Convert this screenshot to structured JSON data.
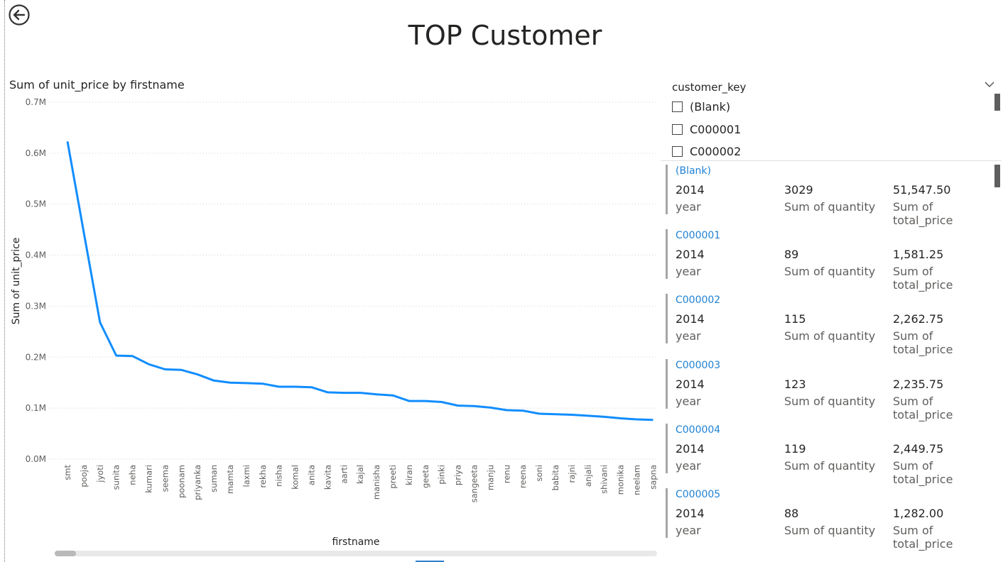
{
  "page": {
    "title": "TOP Customer"
  },
  "chart_data": {
    "type": "line",
    "title": "Sum of unit_price by firstname",
    "xlabel": "firstname",
    "ylabel": "Sum of unit_price",
    "ylim": [
      0,
      700000
    ],
    "yticks": [
      "0.0M",
      "0.1M",
      "0.2M",
      "0.3M",
      "0.4M",
      "0.5M",
      "0.6M",
      "0.7M"
    ],
    "grid": true,
    "color": "#118DFF",
    "categories": [
      "smt",
      "pooja",
      "jyoti",
      "sunita",
      "neha",
      "kumari",
      "seema",
      "poonam",
      "priyanka",
      "suman",
      "mamta",
      "laxmi",
      "rekha",
      "nisha",
      "komal",
      "anita",
      "kavita",
      "aarti",
      "kajal",
      "manisha",
      "preeti",
      "kiran",
      "geeta",
      "pinki",
      "priya",
      "sangeeta",
      "manju",
      "renu",
      "reena",
      "soni",
      "babita",
      "rajni",
      "anjali",
      "shivani",
      "monika",
      "neelam",
      "sapna"
    ],
    "values": [
      623000,
      445000,
      268000,
      203000,
      202000,
      186000,
      176000,
      175000,
      166000,
      154000,
      150000,
      149000,
      148000,
      142000,
      142000,
      141000,
      131000,
      130000,
      130000,
      127000,
      125000,
      114000,
      114000,
      112000,
      105000,
      104000,
      101000,
      96000,
      95000,
      89000,
      88000,
      87000,
      85000,
      83000,
      80000,
      78000,
      77000
    ]
  },
  "slicer": {
    "header": "customer_key",
    "items": [
      "(Blank)",
      "C000001",
      "C000002"
    ]
  },
  "cards": [
    {
      "key": "(Blank)",
      "year": "2014",
      "quantity": "3029",
      "total": "51,547.50"
    },
    {
      "key": "C000001",
      "year": "2014",
      "quantity": "89",
      "total": "1,581.25"
    },
    {
      "key": "C000002",
      "year": "2014",
      "quantity": "115",
      "total": "2,262.75"
    },
    {
      "key": "C000003",
      "year": "2014",
      "quantity": "123",
      "total": "2,235.75"
    },
    {
      "key": "C000004",
      "year": "2014",
      "quantity": "119",
      "total": "2,449.75"
    },
    {
      "key": "C000005",
      "year": "2014",
      "quantity": "88",
      "total": "1,282.00"
    }
  ],
  "card_labels": {
    "year": "year",
    "quantity": "Sum of quantity",
    "total": "Sum of total_price"
  }
}
